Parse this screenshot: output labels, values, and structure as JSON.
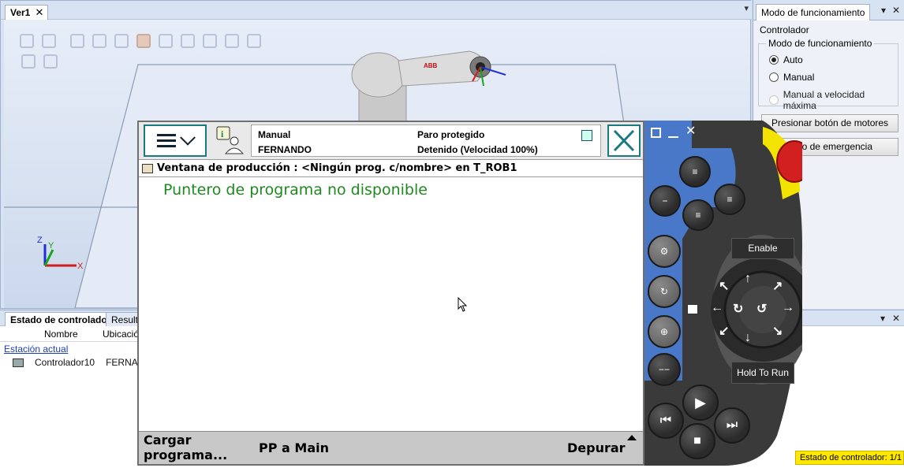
{
  "view": {
    "tab_label": "Ver1",
    "tab_close": "✕",
    "menu_arrow": "▾",
    "robot_brand": "ABB",
    "axis_labels": {
      "x": "X",
      "y": "Y",
      "z": "Z"
    }
  },
  "mode_panel": {
    "tab_label": "Modo de funcionamiento",
    "pin": "▾",
    "close": "✕",
    "controller_label": "Controlador",
    "group_title": "Modo de funcionamiento",
    "options": [
      {
        "label": "Auto",
        "selected": true,
        "enabled": true
      },
      {
        "label": "Manual",
        "selected": false,
        "enabled": true
      },
      {
        "label": "Manual a velocidad máxima",
        "selected": false,
        "enabled": false
      }
    ],
    "motors_button": "Presionar botón de motores",
    "emergency_button": "Paro de emergencia"
  },
  "bottom_pane": {
    "tabs": [
      "Estado de controlador",
      "Resultados"
    ],
    "columns": [
      "Nombre",
      "Ubicación"
    ],
    "station_link": "Estación actual",
    "rows": [
      {
        "name": "Controlador10",
        "location": "FERNANDO"
      }
    ],
    "pin": "▾",
    "close": "✕",
    "status_badge": "Estado de controlador: 1/1"
  },
  "flexpendant": {
    "mode": "Manual",
    "user": "FERNANDO",
    "state": "Paro protegido",
    "speed_state": "Detenido (Velocidad 100%)",
    "production_window": "Ventana de producción : <Ningún prog. c/nombre> en T_ROB1",
    "pointer_message": "Puntero de programa no disponible",
    "bottom_buttons": {
      "load_program": "Cargar programa...",
      "pp_to_main": "PP a Main",
      "debug": "Depurar"
    }
  },
  "pendant": {
    "enable_label": "Enable",
    "hold_to_run_label": "Hold To Run",
    "accent": "#4a78c9",
    "body_color": "#3a3a3a",
    "estop_color": "#d21f1f",
    "housing_color": "#f2e400"
  },
  "icons": [
    "menu-icon",
    "info-user-icon",
    "close-icon",
    "quickset-icon",
    "play-icon",
    "stop-icon",
    "step-back-icon",
    "step-forward-icon",
    "joystick-icon",
    "robot-icon"
  ]
}
